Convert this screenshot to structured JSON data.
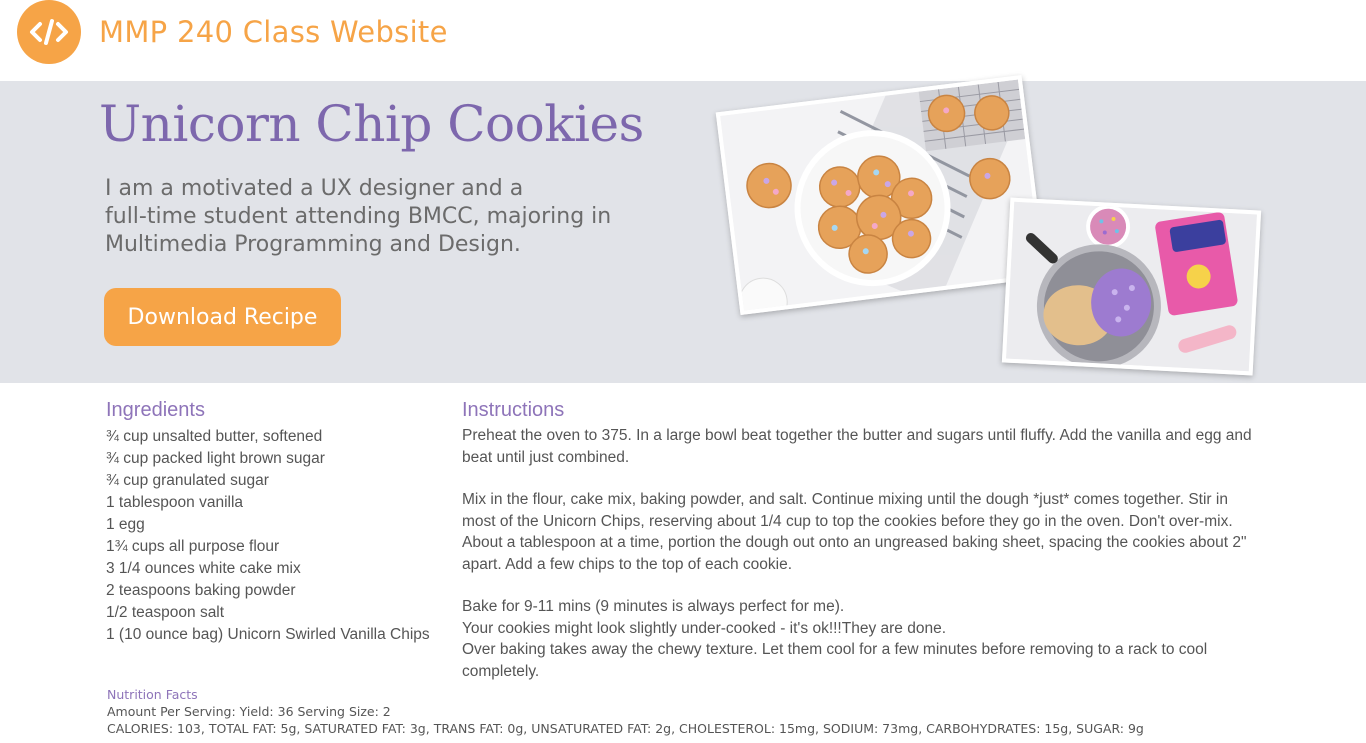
{
  "header": {
    "site_title": "MMP 240 Class Website",
    "logo_icon": "code-brackets-icon",
    "accent_color": "#f6a447"
  },
  "hero": {
    "title": "Unicorn Chip Cookies",
    "intro_line1": "I am a motivated a UX designer and a",
    "intro_line2": "full-time student attending BMCC, majoring in",
    "intro_line3": "Multimedia Programming and Design.",
    "download_label": "Download Recipe",
    "title_color": "#7d67ad",
    "background_color": "#e1e3e8"
  },
  "ingredients": {
    "heading": "Ingredients",
    "items": [
      "¾ cup unsalted butter, softened",
      "¾ cup packed light brown sugar",
      "¾ cup granulated sugar",
      "1 tablespoon vanilla",
      "1 egg",
      "1¾ cups all purpose flour",
      "3 1/4 ounces white cake mix",
      "2 teaspoons baking powder",
      "1/2 teaspoon salt",
      "1 (10 ounce bag) Unicorn Swirled Vanilla Chips"
    ]
  },
  "instructions": {
    "heading": "Instructions",
    "step1": "Preheat the oven to 375. In a large bowl beat together the butter and sugars until fluffy. Add the vanilla and egg and beat until just combined.",
    "step2": "Mix in the flour, cake mix, baking powder, and salt. Continue mixing until the dough *just* comes together. Stir in most of the Unicorn Chips, reserving about 1/4 cup to top the cookies before they go in the oven. Don't over-mix. About a tablespoon at a time, portion the dough out onto an ungreased baking sheet, spacing the cookies about 2\" apart. Add a few chips to the top of each cookie.",
    "step3_line1": "Bake for 9-11 mins (9 minutes is always perfect for me).",
    "step3_line2": "Your cookies might look slightly under-cooked - it's ok!!!They are done.",
    "step3_line3": "Over baking takes away the chewy texture. Let them cool for a few minutes before removing to a rack to cool completely."
  },
  "nutrition": {
    "heading": "Nutrition Facts",
    "serving": "Amount Per Serving: Yield: 36 Serving Size: 2",
    "facts": "CALORIES: 103, TOTAL FAT: 5g, SATURATED FAT: 3g, TRANS FAT: 0g, UNSATURATED FAT: 2g, CHOLESTEROL: 15mg, SODIUM: 73mg, CARBOHYDRATES: 15g,  SUGAR: 9g"
  },
  "images": {
    "photo1_icon": "cookies-plate-photo",
    "photo2_icon": "cookie-dough-bowl-photo"
  }
}
